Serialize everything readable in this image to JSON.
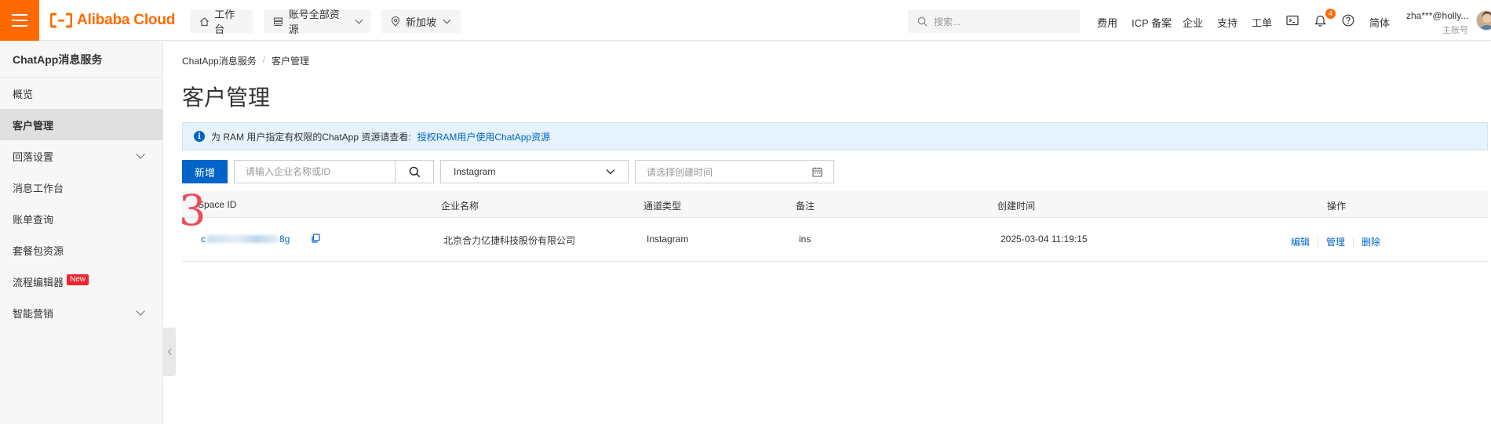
{
  "topbar": {
    "logo_text": "Alibaba Cloud",
    "workbench_label": "工作台",
    "account_label": "账号全部资源",
    "region_label": "新加坡",
    "search_placeholder": "搜索...",
    "links": {
      "cost": "费用",
      "icp": "ICP 备案",
      "enterprise": "企业",
      "support": "支持",
      "ticket": "工单",
      "lang": "简体"
    },
    "notification_count": "4",
    "user_name": "zha***@holly...",
    "user_role": "主账号"
  },
  "sidebar": {
    "title": "ChatApp消息服务",
    "items": [
      {
        "label": "概览"
      },
      {
        "label": "客户管理"
      },
      {
        "label": "回落设置"
      },
      {
        "label": "消息工作台"
      },
      {
        "label": "账单查询"
      },
      {
        "label": "套餐包资源"
      },
      {
        "label": "流程编辑器",
        "badge": "New"
      },
      {
        "label": "智能营销"
      }
    ]
  },
  "breadcrumb": {
    "root": "ChatApp消息服务",
    "sep": "/",
    "current": "客户管理"
  },
  "page": {
    "title": "客户管理"
  },
  "notice": {
    "text": "为 RAM 用户指定有权限的ChatApp 资源请查看:",
    "link": "授权RAM用户使用ChatApp资源"
  },
  "toolbar": {
    "add_label": "新增",
    "search_placeholder": "请输入企业名称或ID",
    "type_value": "Instagram",
    "date_placeholder": "请选择创建时间"
  },
  "table": {
    "headers": {
      "space_id": "Space ID",
      "company": "企业名称",
      "channel": "通道类型",
      "remark": "备注",
      "created": "创建时间",
      "actions": "操作"
    },
    "rows": [
      {
        "space_id_start": "c",
        "space_id_end": "8g",
        "company": "北京合力亿捷科技股份有限公司",
        "channel": "Instagram",
        "remark": "ins",
        "created": "2025-03-04 11:19:15",
        "actions": {
          "edit": "编辑",
          "manage": "管理",
          "delete": "删除"
        }
      }
    ]
  },
  "annotation": {
    "step": "3"
  },
  "colors": {
    "brand": "#ff6a00",
    "primary": "#0064c8",
    "notice_bg": "#e6f3fc",
    "badge": "#f5222d"
  }
}
